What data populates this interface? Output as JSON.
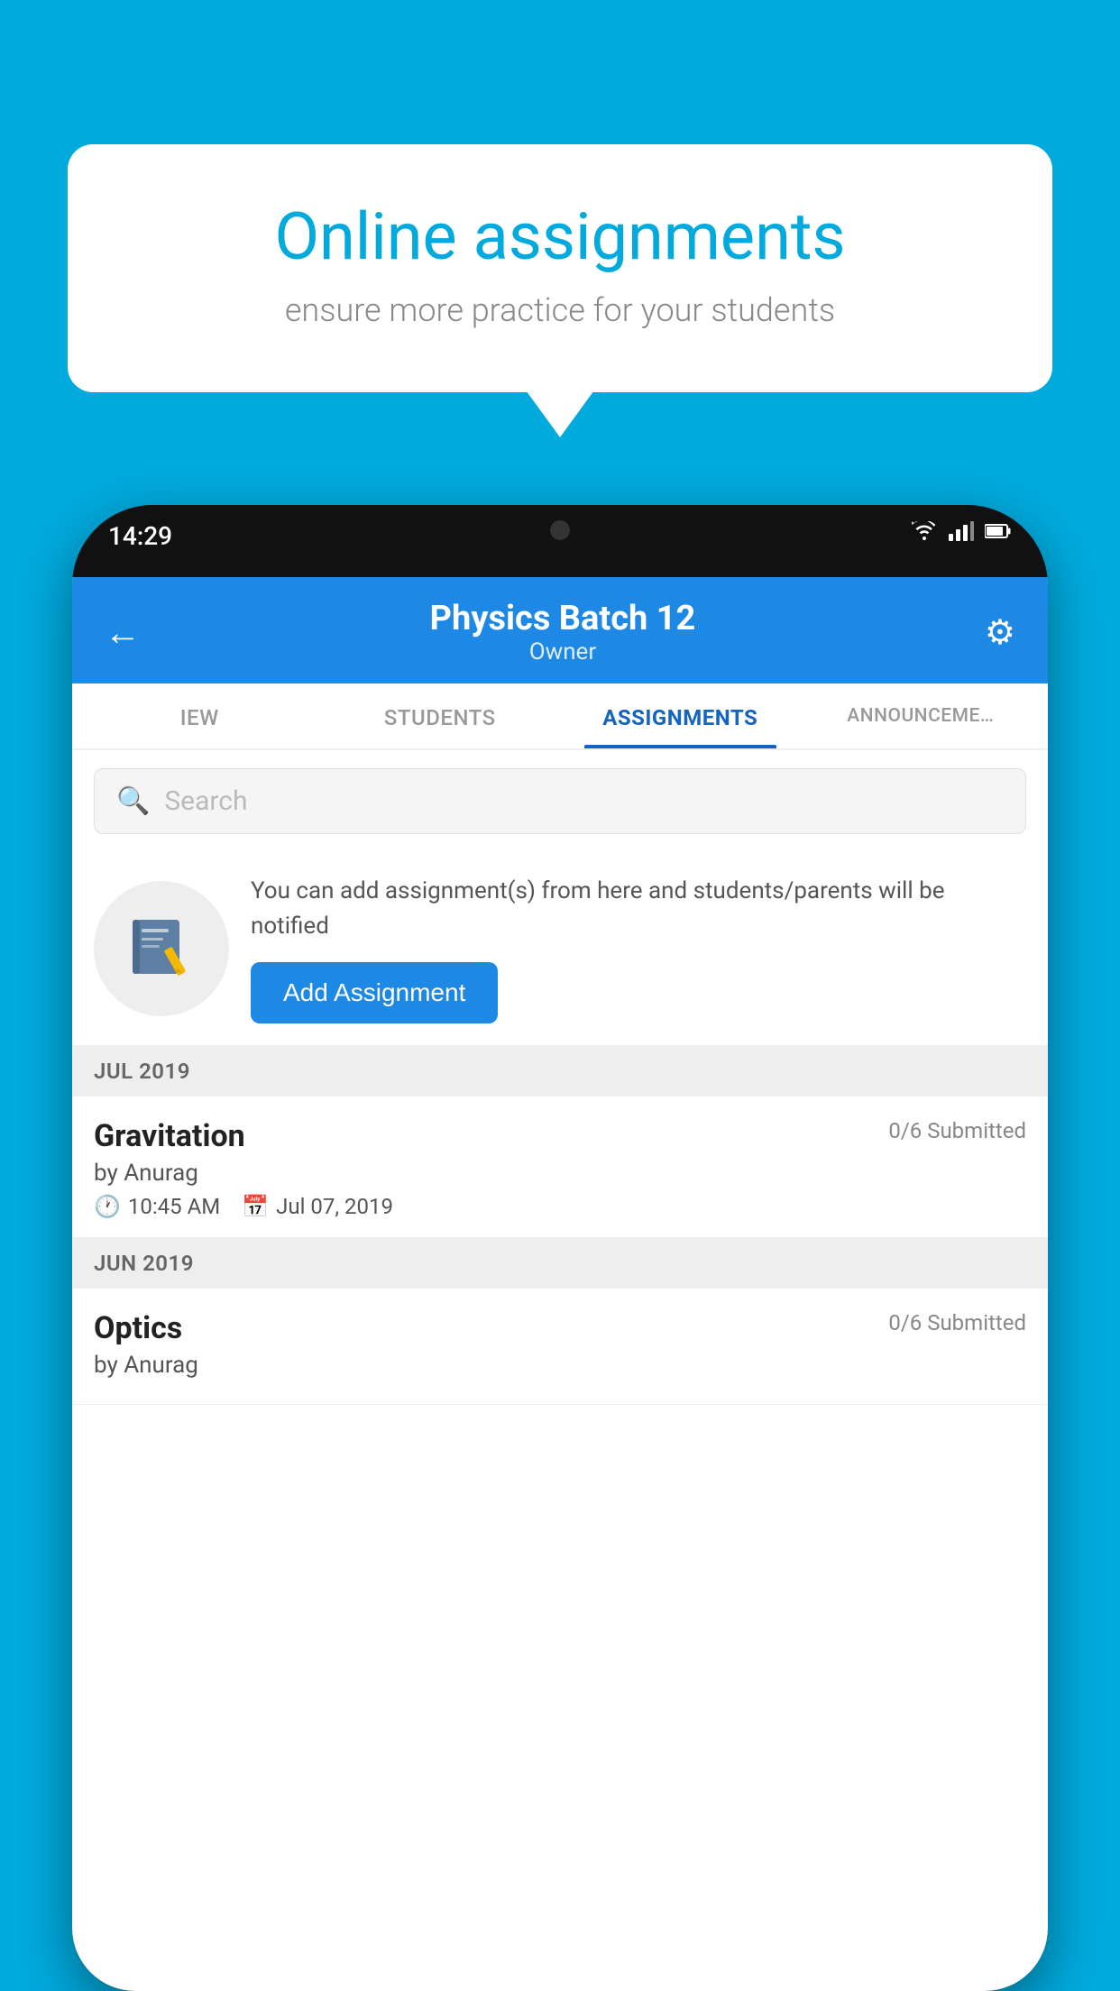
{
  "background_color": "#00AADD",
  "speech_bubble": {
    "title": "Online assignments",
    "subtitle": "ensure more practice for your students"
  },
  "phone": {
    "status_bar": {
      "time": "14:29",
      "icons": [
        "wifi",
        "signal",
        "battery"
      ]
    },
    "header": {
      "title": "Physics Batch 12",
      "subtitle": "Owner"
    },
    "tabs": [
      {
        "label": "IEW",
        "active": false
      },
      {
        "label": "STUDENTS",
        "active": false
      },
      {
        "label": "ASSIGNMENTS",
        "active": true
      },
      {
        "label": "ANNOUNCEME…",
        "active": false
      }
    ],
    "search": {
      "placeholder": "Search"
    },
    "promo": {
      "text": "You can add assignment(s) from here and students/parents will be notified",
      "button_label": "Add Assignment"
    },
    "sections": [
      {
        "month_label": "JUL 2019",
        "assignments": [
          {
            "name": "Gravitation",
            "submitted": "0/6 Submitted",
            "by": "by Anurag",
            "time": "10:45 AM",
            "date": "Jul 07, 2019"
          }
        ]
      },
      {
        "month_label": "JUN 2019",
        "assignments": [
          {
            "name": "Optics",
            "submitted": "0/6 Submitted",
            "by": "by Anurag",
            "time": "",
            "date": ""
          }
        ]
      }
    ]
  }
}
